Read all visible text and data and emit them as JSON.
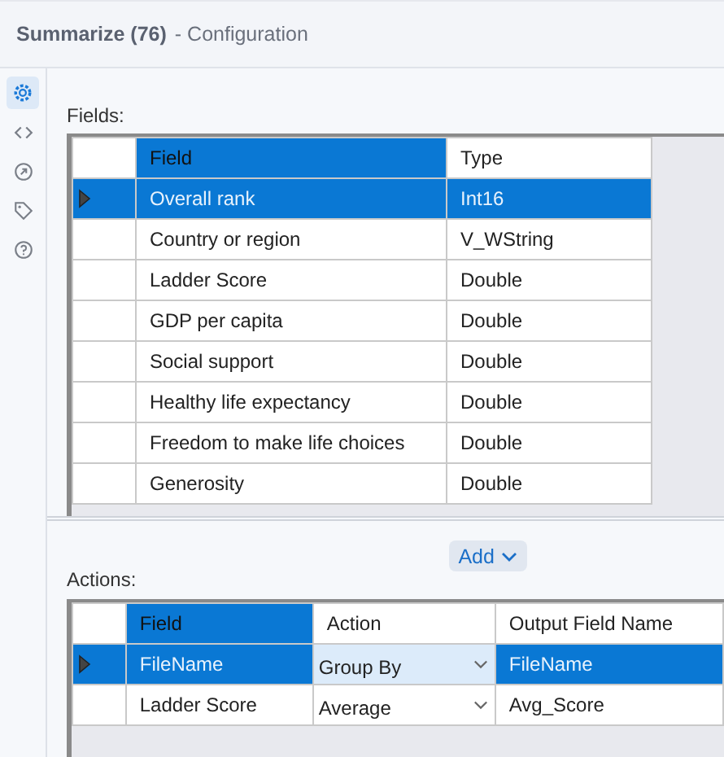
{
  "title": {
    "tool": "Summarize (76)",
    "suffix": "- Configuration"
  },
  "sidebar": {
    "items": [
      {
        "selected": true
      },
      {
        "selected": false
      },
      {
        "selected": false
      },
      {
        "selected": false
      },
      {
        "selected": false
      }
    ]
  },
  "fields": {
    "label": "Fields:",
    "columns": [
      {
        "label": "Field",
        "selected": true
      },
      {
        "label": "Type",
        "selected": false
      }
    ],
    "rows": [
      {
        "field": "Overall rank",
        "type": "Int16",
        "selected": true
      },
      {
        "field": "Country or region",
        "type": "V_WString",
        "selected": false
      },
      {
        "field": "Ladder Score",
        "type": "Double",
        "selected": false
      },
      {
        "field": "GDP per capita",
        "type": "Double",
        "selected": false
      },
      {
        "field": "Social support",
        "type": "Double",
        "selected": false
      },
      {
        "field": "Healthy life expectancy",
        "type": "Double",
        "selected": false
      },
      {
        "field": "Freedom to make life choices",
        "type": "Double",
        "selected": false
      },
      {
        "field": "Generosity",
        "type": "Double",
        "selected": false
      }
    ]
  },
  "actions": {
    "label": "Actions:",
    "add_button": "Add",
    "columns": [
      {
        "label": "Field",
        "selected": true
      },
      {
        "label": "Action",
        "selected": false
      },
      {
        "label": "Output Field Name",
        "selected": false
      }
    ],
    "rows": [
      {
        "field": "FileName",
        "action": "Group By",
        "output": "FileName",
        "selected": true
      },
      {
        "field": "Ladder Score",
        "action": "Average",
        "output": "Avg_Score",
        "selected": false
      }
    ]
  }
}
